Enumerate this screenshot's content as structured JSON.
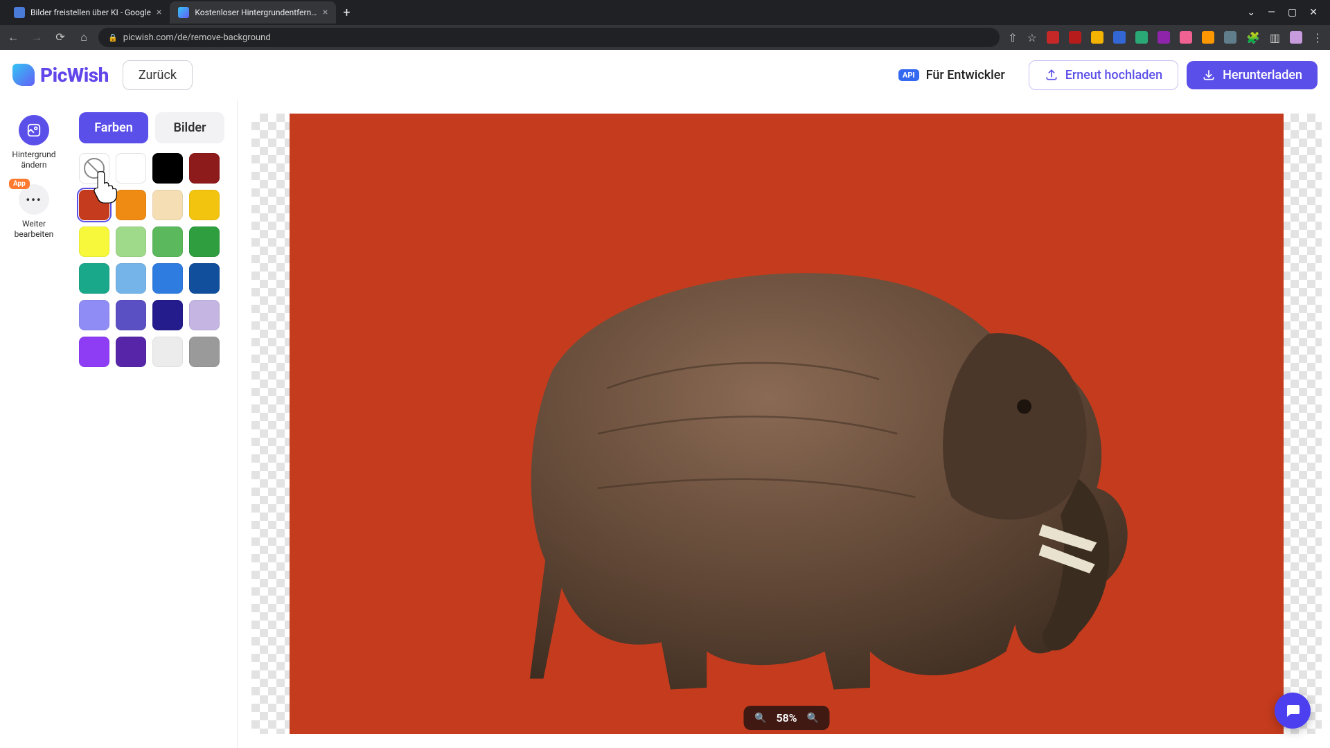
{
  "browser": {
    "tabs": [
      {
        "title": "Bilder freistellen über KI - Google",
        "favicon": "#4a7bd8",
        "active": false
      },
      {
        "title": "Kostenloser Hintergrundentferner",
        "favicon": "#33c5f3",
        "active": true
      }
    ],
    "url": "picwish.com/de/remove-background",
    "window_controls": {
      "dropdown": "⌄",
      "min": "—",
      "max": "▢",
      "close": "✕"
    },
    "extensions": [
      "#c62828",
      "#c62828",
      "#2e7d32",
      "#f5b301",
      "#3367d6",
      "#2aa876",
      "#8e24aa",
      "#f06292",
      "#9c27b0",
      "#607d8b",
      "#555555",
      "#9e9e9e"
    ]
  },
  "topbar": {
    "brand": "PicWish",
    "back": "Zurück",
    "api_label": "Für Entwickler",
    "api_badge": "API",
    "reupload": "Erneut hochladen",
    "download": "Herunterladen"
  },
  "rail": {
    "change_bg_line1": "Hintergrund",
    "change_bg_line2": "ändern",
    "more_badge": "App",
    "more_line1": "Weiter",
    "more_line2": "bearbeiten"
  },
  "panel": {
    "tab_colors": "Farben",
    "tab_images": "Bilder",
    "selected_color": "#c53b1d",
    "colors": [
      "none",
      "#ffffff",
      "#000000",
      "#8e1b1b",
      "#c53b1d",
      "#ef8a12",
      "#f5deb3",
      "#f2c40f",
      "#f7f73b",
      "#9fd98a",
      "#5cb85c",
      "#2e9e3f",
      "#1aa88a",
      "#74b4e8",
      "#2f7ce0",
      "#114e9c",
      "#8f8cf5",
      "#5b4fc4",
      "#241b8c",
      "#c5b5e3",
      "#8f3cf5",
      "#5726a8",
      "#ececec",
      "#9a9a9a"
    ]
  },
  "canvas": {
    "bg_color": "#c53b1d",
    "subject": "elephant",
    "zoom_label": "58%"
  },
  "icons": {
    "zoom_out": "🔍-",
    "zoom_in": "🔍+"
  }
}
